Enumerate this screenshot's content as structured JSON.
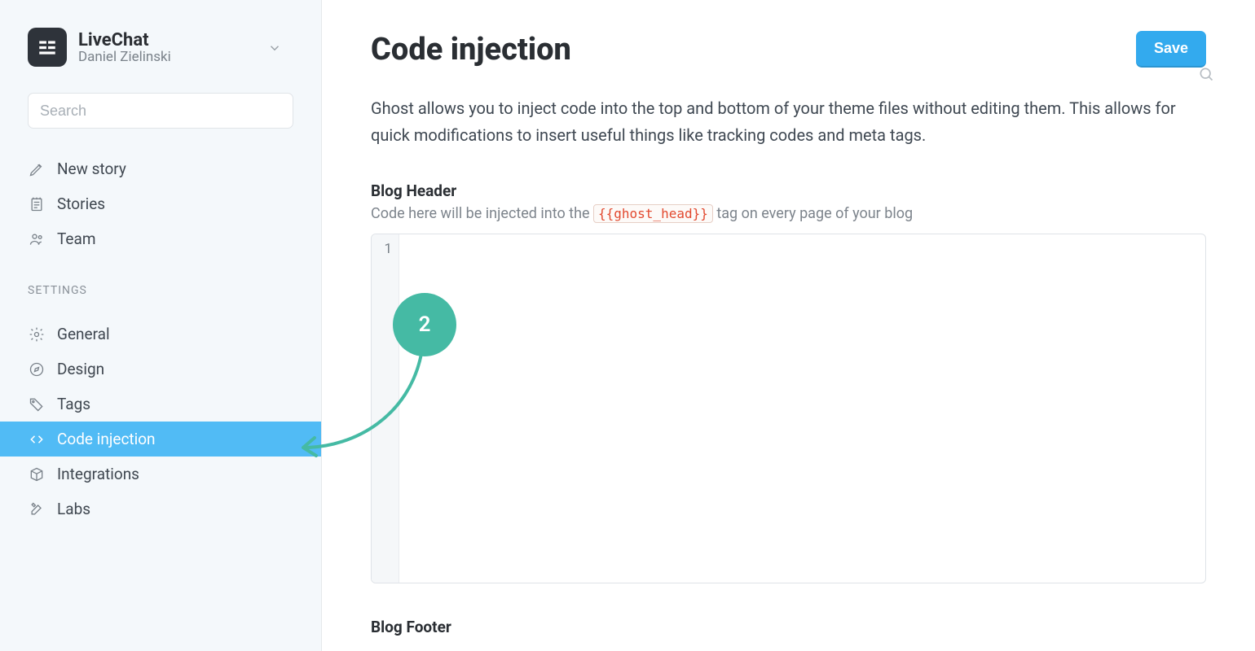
{
  "brand": {
    "title": "LiveChat",
    "subtitle": "Daniel Zielinski"
  },
  "search": {
    "placeholder": "Search"
  },
  "nav": {
    "items": [
      {
        "label": "New story"
      },
      {
        "label": "Stories"
      },
      {
        "label": "Team"
      }
    ]
  },
  "settings": {
    "label": "SETTINGS",
    "items": [
      {
        "label": "General"
      },
      {
        "label": "Design"
      },
      {
        "label": "Tags"
      },
      {
        "label": "Code injection",
        "active": true
      },
      {
        "label": "Integrations"
      },
      {
        "label": "Labs"
      }
    ]
  },
  "page": {
    "title": "Code injection",
    "save_label": "Save",
    "description": "Ghost allows you to inject code into the top and bottom of your theme files without editing them. This allows for quick modifications to insert useful things like tracking codes and meta tags."
  },
  "header_section": {
    "title": "Blog Header",
    "sub_prefix": "Code here will be injected into the ",
    "code_tag": "{{ghost_head}}",
    "sub_suffix": " tag on every page of your blog",
    "line_number": "1"
  },
  "footer_section": {
    "title": "Blog Footer"
  },
  "annotation": {
    "label": "2"
  }
}
